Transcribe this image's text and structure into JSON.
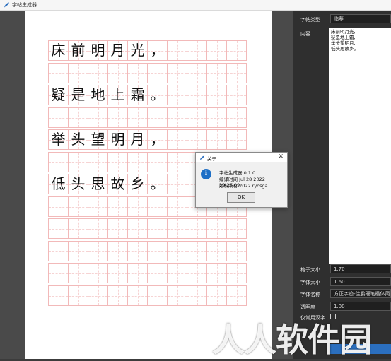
{
  "window": {
    "title": "字帖生成器"
  },
  "practice_sheet": {
    "rows": [
      {
        "chars": [
          "床",
          "前",
          "明",
          "月",
          "光",
          "，"
        ]
      },
      {
        "chars": []
      },
      {
        "chars": [
          "疑",
          "是",
          "地",
          "上",
          "霜",
          "。"
        ]
      },
      {
        "chars": []
      },
      {
        "chars": [
          "举",
          "头",
          "望",
          "明",
          "月",
          "，"
        ]
      },
      {
        "chars": []
      },
      {
        "chars": [
          "低",
          "头",
          "思",
          "故",
          "乡",
          "。"
        ]
      },
      {
        "chars": []
      },
      {
        "chars": []
      },
      {
        "chars": []
      },
      {
        "chars": []
      },
      {
        "chars": []
      }
    ]
  },
  "panel": {
    "type_label": "字帖类型",
    "type_value": "临摹",
    "content_label": "内容",
    "content_lines": [
      "床前明月光,",
      "疑是地上霜,",
      "举头望明月,",
      "低头思故乡。"
    ],
    "grid_size_label": "格子大小",
    "grid_size_value": "1.70",
    "font_size_label": "字体大小",
    "font_size_value": "1.60",
    "font_name_label": "字体名称",
    "font_name_value": "方正字迹-佳鹏硬笔楷体简体",
    "opacity_label": "透明度",
    "opacity_value": "1.00",
    "only_common_label": "仅常用汉字"
  },
  "about_dialog": {
    "title": "关于",
    "line1": "字帖生成器 0.1.0",
    "line2": "编译时间 Jul 28 2022 19:26:09",
    "line3": "版权所有 2022 ryosga",
    "ok_label": "OK",
    "icon": "info-icon"
  },
  "watermark": {
    "text": "人人软件园"
  },
  "colors": {
    "accent": "#2b6fbf",
    "grid_line": "#f2b9b9",
    "info": "#1d6fc6"
  }
}
